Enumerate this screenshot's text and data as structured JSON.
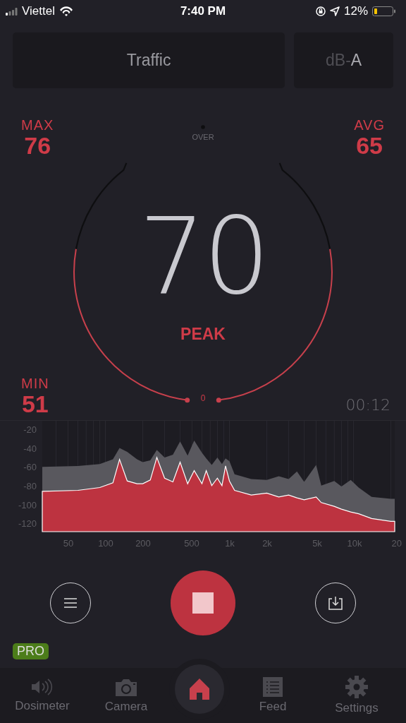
{
  "status_bar": {
    "carrier": "Viettel",
    "time": "7:40 PM",
    "battery": "12%"
  },
  "mode": {
    "preset": "Traffic",
    "unit_prefix": "dB-",
    "weighting": "A"
  },
  "stats": {
    "max_label": "MAX",
    "max": "76",
    "avg_label": "AVG",
    "avg": "65",
    "min_label": "MIN",
    "min": "51"
  },
  "gauge": {
    "value": "70",
    "caption": "PEAK",
    "over_label": "OVER",
    "zero_label": "0",
    "timer": "00:12"
  },
  "spectrum": {
    "y_labels": [
      "-20",
      "-40",
      "-60",
      "-80",
      "-100",
      "-120"
    ],
    "x_labels": [
      "50",
      "100",
      "200",
      "500",
      "1k",
      "2k",
      "5k",
      "10k",
      "20"
    ]
  },
  "controls": {
    "badge": "PRO"
  },
  "tabs": [
    {
      "label": "Dosimeter",
      "selected": false
    },
    {
      "label": "Camera",
      "selected": false
    },
    {
      "selected": true
    },
    {
      "label": "Feed",
      "selected": false
    },
    {
      "label": "Settings",
      "selected": false
    }
  ]
}
